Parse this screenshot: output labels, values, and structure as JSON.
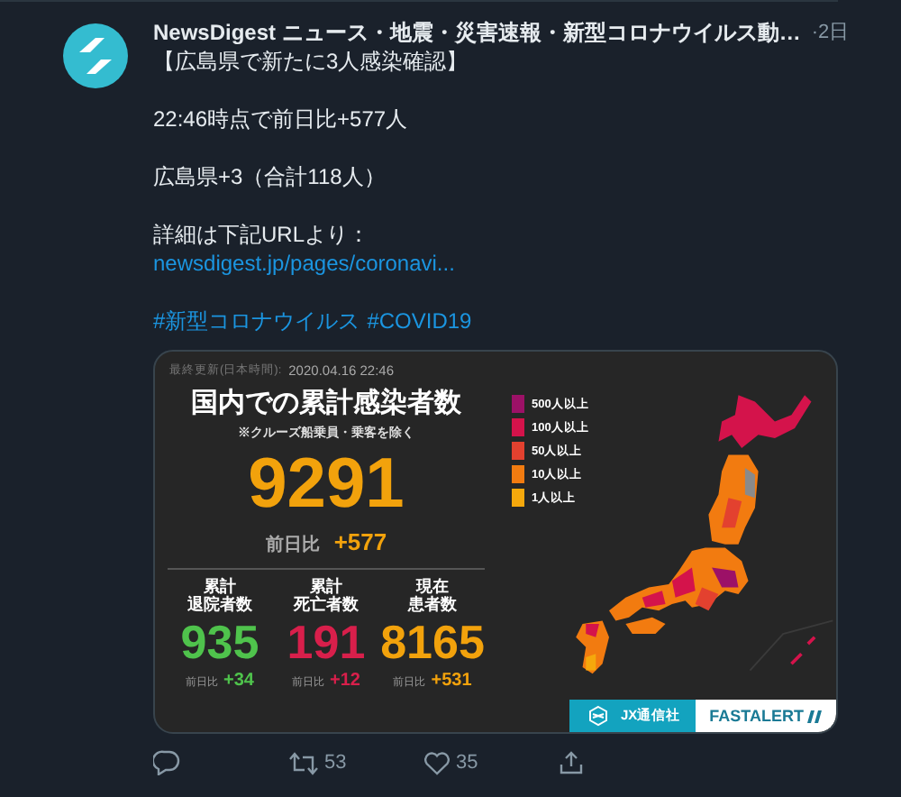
{
  "tweet": {
    "author": "NewsDigest ニュース・地震・災害速報・新型コロナウイルス動…",
    "time": "·2日",
    "paragraphs": [
      [
        "【広島県で新たに3人感染確認】"
      ],
      [
        "22:46時点で前日比+577人"
      ],
      [
        "広島県+3（合計118人）"
      ],
      [
        "詳細は下記URLより："
      ]
    ],
    "link": "newsdigest.jp/pages/coronavi...",
    "hashtags": [
      "#新型コロナウイルス",
      "#COVID19"
    ]
  },
  "infographic": {
    "updated_label": "最終更新(日本時間):",
    "updated": "2020.04.16 22:46",
    "title": "国内での累計感染者数",
    "note": "※クルーズ船乗員・乗客を除く",
    "total": "9291",
    "change_label": "前日比",
    "change": "+577",
    "stats": [
      {
        "label_lines": [
          "累計",
          "退院者数"
        ],
        "value": "935",
        "change_label": "前日比",
        "change": "+34",
        "color": "#4fc34c"
      },
      {
        "label_lines": [
          "累計",
          "死亡者数"
        ],
        "value": "191",
        "change_label": "前日比",
        "change": "+12",
        "color": "#d81f4b"
      },
      {
        "label_lines": [
          "現在",
          "患者数"
        ],
        "value": "8165",
        "change_label": "前日比",
        "change": "+531",
        "color": "#f2a20c"
      }
    ],
    "legend": [
      {
        "label": "500人以上",
        "color": "#9c1167"
      },
      {
        "label": "100人以上",
        "color": "#d4134b"
      },
      {
        "label": "50人以上",
        "color": "#e3412f"
      },
      {
        "label": "10人以上",
        "color": "#f27b10"
      },
      {
        "label": "1人以上",
        "color": "#f5a80c"
      }
    ],
    "brands": [
      "JX通信社",
      "FASTALERT"
    ]
  },
  "actions": [
    {
      "kind": "reply"
    },
    {
      "kind": "retweet",
      "count": "53"
    },
    {
      "kind": "like",
      "count": "35"
    },
    {
      "kind": "share"
    }
  ]
}
